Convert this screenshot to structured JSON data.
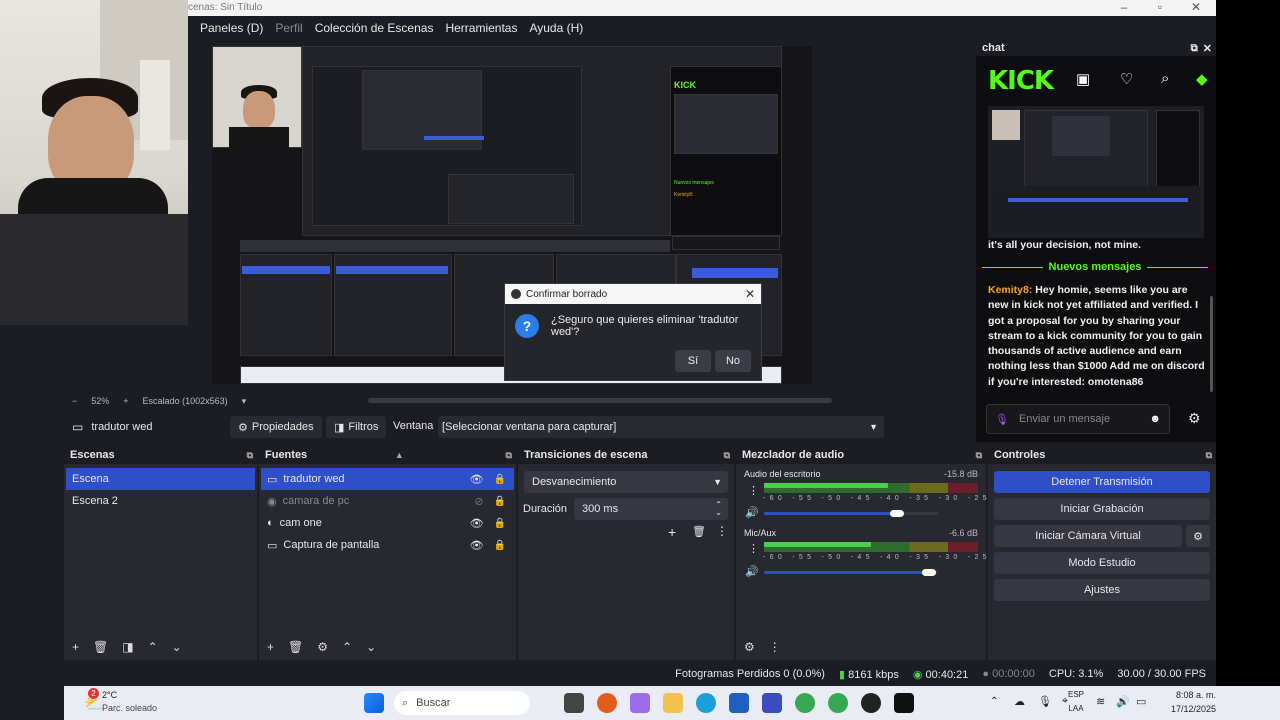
{
  "window": {
    "title": "cenas: Sin Título"
  },
  "menu": [
    "Paneles (D)",
    "Perfil",
    "Colección de Escenas",
    "Herramientas",
    "Ayuda (H)"
  ],
  "dialog": {
    "title": "Confirmar borrado",
    "message": "¿Seguro que quieres eliminar 'tradutor wed'?",
    "yes": "Sí",
    "no": "No"
  },
  "zoom": {
    "percent": "52%",
    "scaled": "Escalado (1002x563)"
  },
  "source_toolbar": {
    "source_name": "tradutor wed",
    "properties": "Propiedades",
    "filters": "Filtros",
    "window_label": "Ventana",
    "window_value": "[Seleccionar ventana para capturar]"
  },
  "scenes": {
    "title": "Escenas",
    "items": [
      "Escena",
      "Escena 2"
    ]
  },
  "sources": {
    "title": "Fuentes",
    "items": [
      "tradutor wed",
      "camara de pc",
      "cam one",
      "Captura de pantalla"
    ]
  },
  "transitions": {
    "title": "Transiciones de escena",
    "type": "Desvanecimiento",
    "duration_label": "Duración",
    "duration_value": "300 ms"
  },
  "mixer": {
    "title": "Mezclador de audio",
    "channels": [
      {
        "name": "Audio del escritorio",
        "db": "-15.8 dB",
        "level": 0.58,
        "volume": 0.79
      },
      {
        "name": "Mic/Aux",
        "db": "-6.6 dB",
        "level": 0.5,
        "volume": 0.99
      }
    ],
    "scale": "-60 -55 -50 -45 -40 -35 -30 -25 -20 -15 -10 -5 0"
  },
  "controls": {
    "title": "Controles",
    "buttons": [
      "Detener Transmisión",
      "Iniciar Grabación",
      "Iniciar Cámara Virtual",
      "Modo Estudio",
      "Ajustes"
    ]
  },
  "chat": {
    "title": "chat",
    "logo": "KICK",
    "prev_message": "it's all your decision, not mine.",
    "new_messages": "Nuevos mensajes",
    "username": "Kemity8:",
    "message": "Hey homie, seems like you are new in kick not yet affiliated and verified. I got a proposal for you by sharing your stream to a kick community for you to gain thousands of active audience and earn nothing less than $1000 Add me on discord if you're interested: omotena86",
    "input_placeholder": "Enviar un mensaje"
  },
  "status": {
    "dropped": "Fotogramas Perdidos 0 (0.0%)",
    "kbps": "8161 kbps",
    "live": "00:40:21",
    "rec": "00:00:00",
    "cpu": "CPU: 3.1%",
    "fps": "30.00 / 30.00 FPS"
  },
  "taskbar": {
    "temp": "2°C",
    "weather": "Parc. soleado",
    "weather_badge": "2",
    "search": "Buscar",
    "lang1": "ESP",
    "lang2": "LAA",
    "time": "8:08 a. m.",
    "date": "17/12/2025"
  },
  "colors": {
    "accent": "#2e4fc7",
    "kick_green": "#53fc18",
    "username": "#f5a623"
  }
}
